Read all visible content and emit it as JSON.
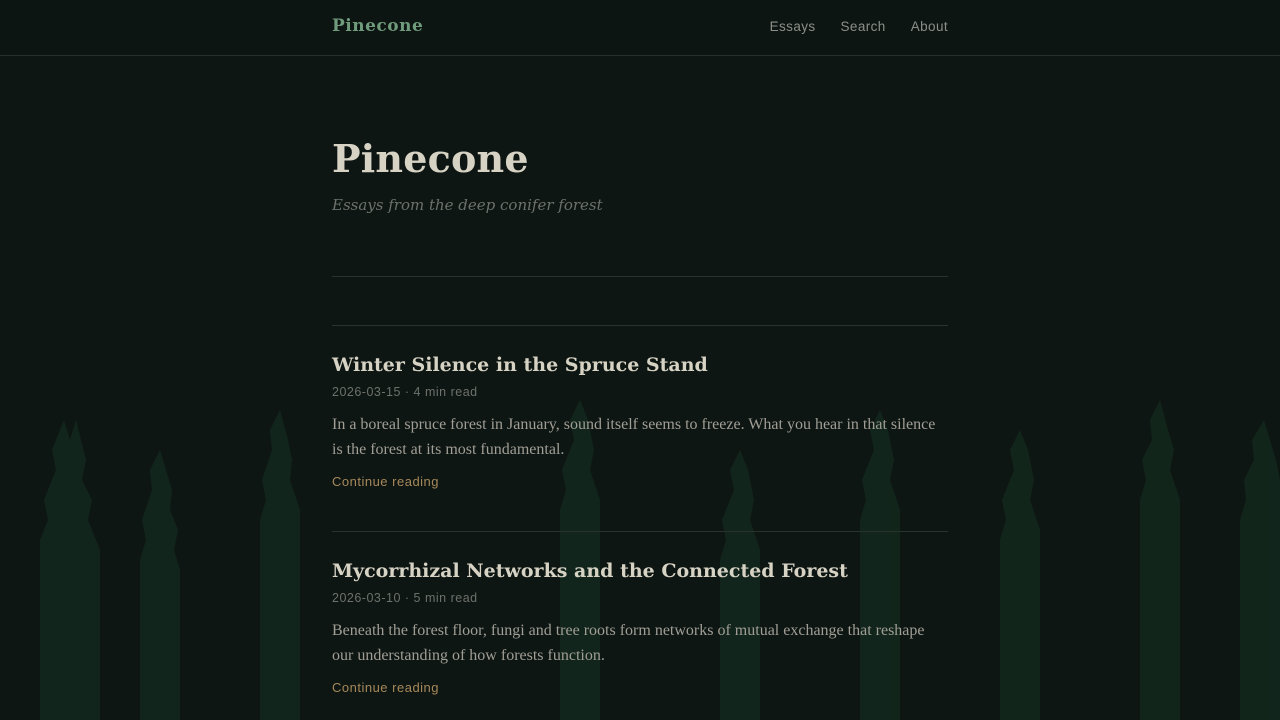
{
  "header": {
    "brand": "Pinecone",
    "nav": [
      {
        "label": "Essays"
      },
      {
        "label": "Search"
      },
      {
        "label": "About"
      }
    ]
  },
  "hero": {
    "title": "Pinecone",
    "tagline": "Essays from the deep conifer forest"
  },
  "posts": [
    {
      "title": "Winter Silence in the Spruce Stand",
      "meta": "2026-03-15 · 4 min read",
      "excerpt": "In a boreal spruce forest in January, sound itself seems to freeze. What you hear in that silence is the forest at its most fundamental.",
      "link": "Continue reading"
    },
    {
      "title": "Mycorrhizal Networks and the Connected Forest",
      "meta": "2026-03-10 · 5 min read",
      "excerpt": "Beneath the forest floor, fungi and tree roots form networks of mutual exchange that reshape our understanding of how forests function.",
      "link": "Continue reading"
    }
  ],
  "colors": {
    "background": "#0e1613",
    "accent": "#6f9a7c",
    "link": "#a58859",
    "tree": "#14281e"
  }
}
